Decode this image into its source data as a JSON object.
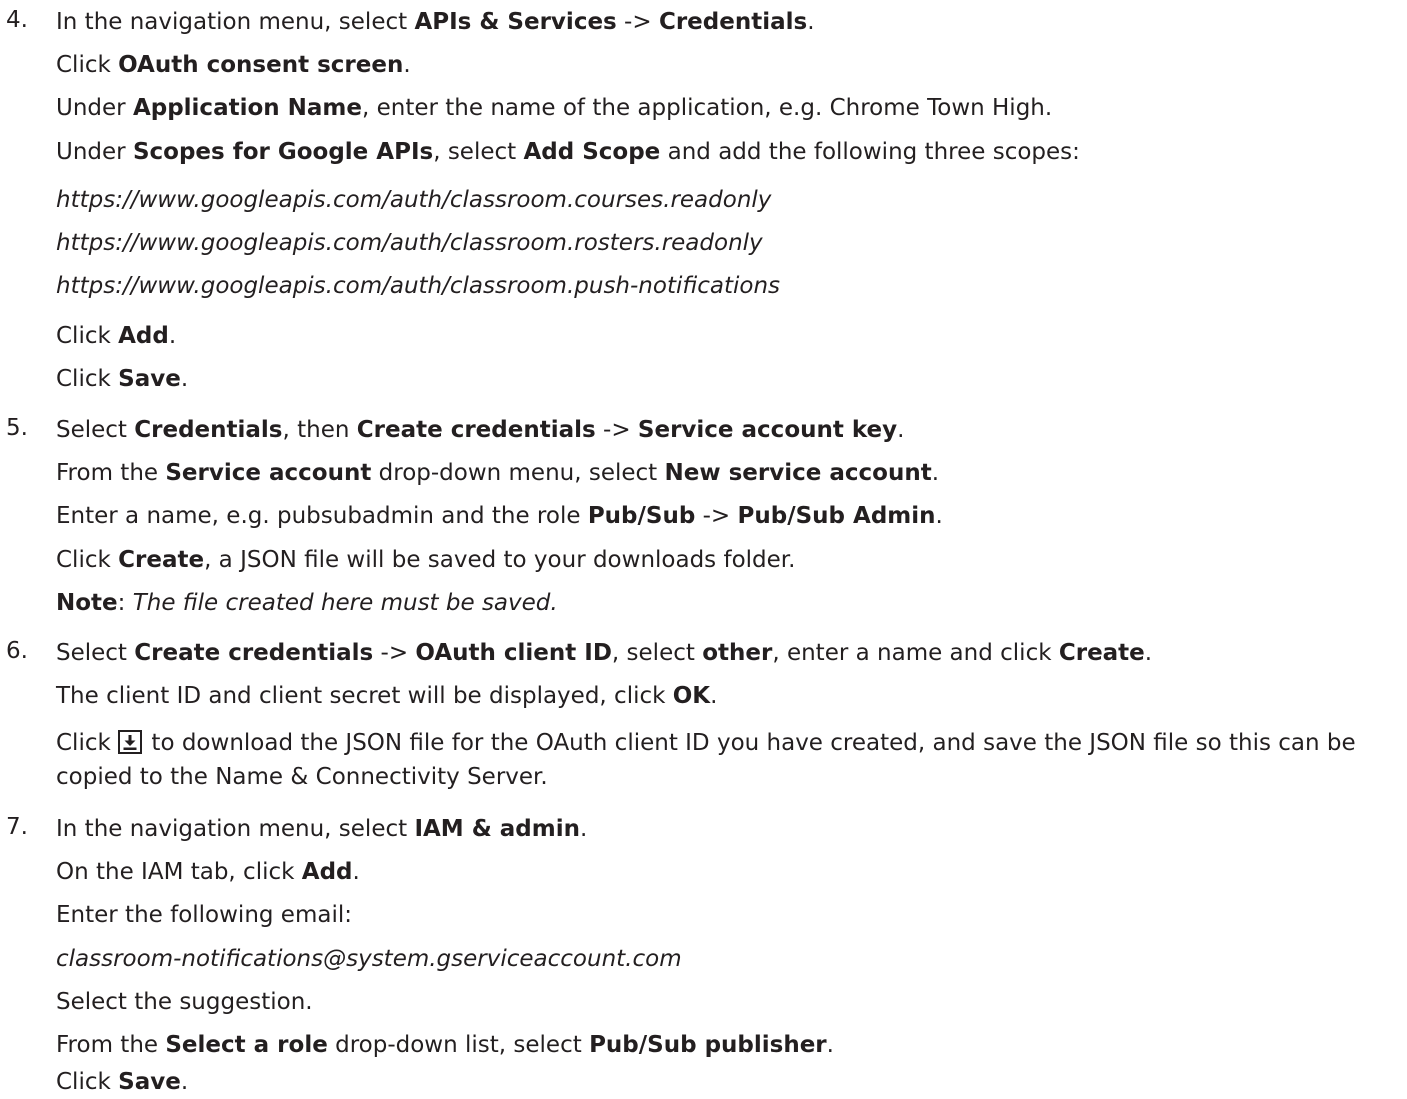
{
  "steps": [
    {
      "number": "4.",
      "lines": [
        [
          "In the navigation menu, select ",
          "APIs & Services",
          " -> ",
          "Credentials",
          "."
        ],
        [
          "Click ",
          "OAuth consent screen",
          "."
        ],
        [
          "Under ",
          "Application Name",
          ", enter the name of the application, e.g. Chrome Town High."
        ],
        [
          "Under ",
          "Scopes for Google APIs",
          ", select ",
          "Add Scope",
          " and add the following three scopes:"
        ]
      ],
      "scopes": [
        "https://www.googleapis.com/auth/classroom.courses.readonly",
        "https://www.googleapis.com/auth/classroom.rosters.readonly",
        "https://www.googleapis.com/auth/classroom.push-notifications"
      ],
      "after": [
        [
          "Click ",
          "Add",
          "."
        ],
        [
          "Click ",
          "Save",
          "."
        ]
      ]
    },
    {
      "number": "5.",
      "lines": [
        [
          "Select ",
          "Credentials",
          ", then ",
          "Create credentials",
          " -> ",
          "Service account key",
          "."
        ],
        [
          "From the ",
          "Service account",
          " drop-down menu, select ",
          "New service account",
          "."
        ],
        [
          "Enter a name, e.g. pubsubadmin and the role ",
          "Pub/Sub",
          " -> ",
          "Pub/Sub Admin",
          "."
        ],
        [
          "Click ",
          "Create",
          ", a JSON file will be saved to your downloads folder."
        ]
      ],
      "note_label": "Note",
      "note_sep": ": ",
      "note_text": "The file created here must be saved."
    },
    {
      "number": "6.",
      "lines": [
        [
          "Select ",
          "Create credentials",
          " -> ",
          "OAuth client ID",
          ", select ",
          "other",
          ", enter a name and click ",
          "Create",
          "."
        ],
        [
          "The client ID and client secret will be displayed, click ",
          "OK",
          "."
        ]
      ],
      "icon": "download-icon",
      "click_prefix": "Click ",
      "click_suffix": " to download the JSON file for the OAuth client ID you have created, and save the JSON file so this can be copied to the Name & Connectivity Server."
    },
    {
      "number": "7.",
      "lines": [
        [
          "In the navigation menu, select ",
          "IAM & admin",
          "."
        ],
        [
          "On the IAM tab, click ",
          "Add",
          "."
        ],
        [
          "Enter the following email:"
        ]
      ],
      "email": "classroom-notifications@system.gserviceaccount.com",
      "after": [
        [
          "Select the suggestion."
        ],
        [
          "From the ",
          "Select a role",
          " drop-down list, select ",
          "Pub/Sub publisher",
          "."
        ],
        [
          "Click ",
          "Save",
          "."
        ]
      ]
    }
  ],
  "colors": {
    "text": "#231f20",
    "background": "#ffffff"
  }
}
